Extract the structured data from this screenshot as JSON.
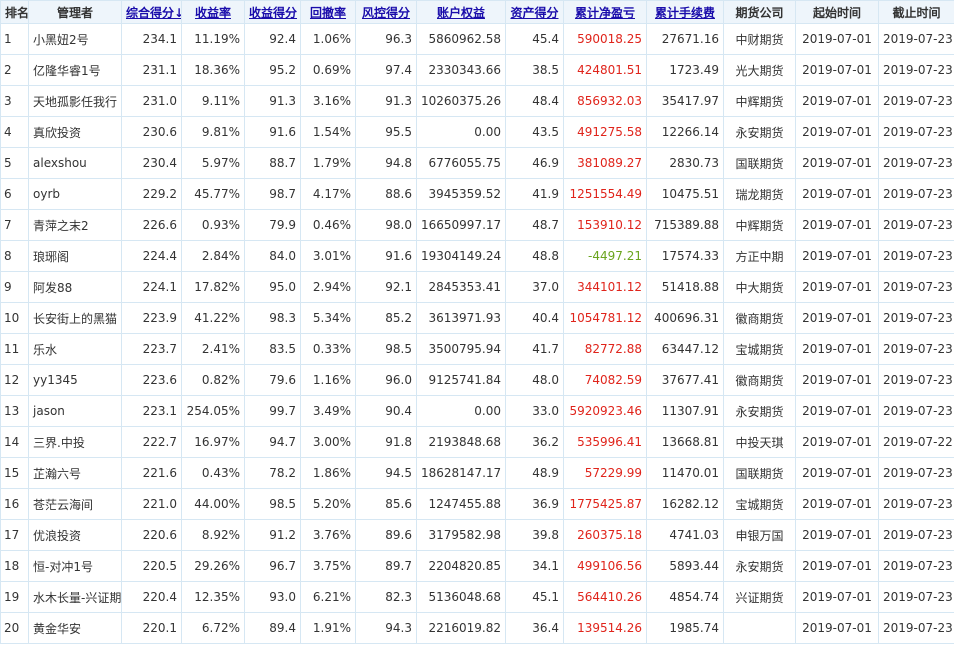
{
  "columns": [
    {
      "key": "rank",
      "label": "排名",
      "sortable": false
    },
    {
      "key": "manager",
      "label": "管理者",
      "sortable": false
    },
    {
      "key": "total_score",
      "label": "综合得分↓",
      "sortable": true
    },
    {
      "key": "return_rate",
      "label": "收益率",
      "sortable": true
    },
    {
      "key": "return_score",
      "label": "收益得分",
      "sortable": true
    },
    {
      "key": "drawdown",
      "label": "回撤率",
      "sortable": true
    },
    {
      "key": "risk_score",
      "label": "风控得分",
      "sortable": true
    },
    {
      "key": "equity",
      "label": "账户权益",
      "sortable": true
    },
    {
      "key": "asset_score",
      "label": "资产得分",
      "sortable": true
    },
    {
      "key": "net_pnl",
      "label": "累计净盈亏",
      "sortable": true
    },
    {
      "key": "fees",
      "label": "累计手续费",
      "sortable": true
    },
    {
      "key": "broker",
      "label": "期货公司",
      "sortable": false
    },
    {
      "key": "start",
      "label": "起始时间",
      "sortable": false
    },
    {
      "key": "end",
      "label": "截止时间",
      "sortable": false
    }
  ],
  "rows": [
    {
      "rank": "1",
      "manager": "小黑妞2号",
      "total_score": "234.1",
      "return_rate": "11.19%",
      "return_score": "92.4",
      "drawdown": "1.06%",
      "risk_score": "96.3",
      "equity": "5860962.58",
      "asset_score": "45.4",
      "net_pnl": "590018.25",
      "fees": "27671.16",
      "broker": "中财期货",
      "start": "2019-07-01",
      "end": "2019-07-23"
    },
    {
      "rank": "2",
      "manager": "亿隆华睿1号",
      "total_score": "231.1",
      "return_rate": "18.36%",
      "return_score": "95.2",
      "drawdown": "0.69%",
      "risk_score": "97.4",
      "equity": "2330343.66",
      "asset_score": "38.5",
      "net_pnl": "424801.51",
      "fees": "1723.49",
      "broker": "光大期货",
      "start": "2019-07-01",
      "end": "2019-07-23"
    },
    {
      "rank": "3",
      "manager": "天地孤影任我行",
      "total_score": "231.0",
      "return_rate": "9.11%",
      "return_score": "91.3",
      "drawdown": "3.16%",
      "risk_score": "91.3",
      "equity": "10260375.26",
      "asset_score": "48.4",
      "net_pnl": "856932.03",
      "fees": "35417.97",
      "broker": "中辉期货",
      "start": "2019-07-01",
      "end": "2019-07-23"
    },
    {
      "rank": "4",
      "manager": "真欣投资",
      "total_score": "230.6",
      "return_rate": "9.81%",
      "return_score": "91.6",
      "drawdown": "1.54%",
      "risk_score": "95.5",
      "equity": "0.00",
      "asset_score": "43.5",
      "net_pnl": "491275.58",
      "fees": "12266.14",
      "broker": "永安期货",
      "start": "2019-07-01",
      "end": "2019-07-23"
    },
    {
      "rank": "5",
      "manager": "alexshou",
      "total_score": "230.4",
      "return_rate": "5.97%",
      "return_score": "88.7",
      "drawdown": "1.79%",
      "risk_score": "94.8",
      "equity": "6776055.75",
      "asset_score": "46.9",
      "net_pnl": "381089.27",
      "fees": "2830.73",
      "broker": "国联期货",
      "start": "2019-07-01",
      "end": "2019-07-23"
    },
    {
      "rank": "6",
      "manager": "oyrb",
      "total_score": "229.2",
      "return_rate": "45.77%",
      "return_score": "98.7",
      "drawdown": "4.17%",
      "risk_score": "88.6",
      "equity": "3945359.52",
      "asset_score": "41.9",
      "net_pnl": "1251554.49",
      "fees": "10475.51",
      "broker": "瑞龙期货",
      "start": "2019-07-01",
      "end": "2019-07-23"
    },
    {
      "rank": "7",
      "manager": "青萍之末2",
      "total_score": "226.6",
      "return_rate": "0.93%",
      "return_score": "79.9",
      "drawdown": "0.46%",
      "risk_score": "98.0",
      "equity": "16650997.17",
      "asset_score": "48.7",
      "net_pnl": "153910.12",
      "fees": "715389.88",
      "broker": "中辉期货",
      "start": "2019-07-01",
      "end": "2019-07-23"
    },
    {
      "rank": "8",
      "manager": "琅琊阁",
      "total_score": "224.4",
      "return_rate": "2.84%",
      "return_score": "84.0",
      "drawdown": "3.01%",
      "risk_score": "91.6",
      "equity": "19304149.24",
      "asset_score": "48.8",
      "net_pnl": "-4497.21",
      "fees": "17574.33",
      "broker": "方正中期",
      "start": "2019-07-01",
      "end": "2019-07-23"
    },
    {
      "rank": "9",
      "manager": "阿发88",
      "total_score": "224.1",
      "return_rate": "17.82%",
      "return_score": "95.0",
      "drawdown": "2.94%",
      "risk_score": "92.1",
      "equity": "2845353.41",
      "asset_score": "37.0",
      "net_pnl": "344101.12",
      "fees": "51418.88",
      "broker": "中大期货",
      "start": "2019-07-01",
      "end": "2019-07-23"
    },
    {
      "rank": "10",
      "manager": "长安街上的黑猫",
      "total_score": "223.9",
      "return_rate": "41.22%",
      "return_score": "98.3",
      "drawdown": "5.34%",
      "risk_score": "85.2",
      "equity": "3613971.93",
      "asset_score": "40.4",
      "net_pnl": "1054781.12",
      "fees": "400696.31",
      "broker": "徽商期货",
      "start": "2019-07-01",
      "end": "2019-07-23"
    },
    {
      "rank": "11",
      "manager": "乐水",
      "total_score": "223.7",
      "return_rate": "2.41%",
      "return_score": "83.5",
      "drawdown": "0.33%",
      "risk_score": "98.5",
      "equity": "3500795.94",
      "asset_score": "41.7",
      "net_pnl": "82772.88",
      "fees": "63447.12",
      "broker": "宝城期货",
      "start": "2019-07-01",
      "end": "2019-07-23"
    },
    {
      "rank": "12",
      "manager": "yy1345",
      "total_score": "223.6",
      "return_rate": "0.82%",
      "return_score": "79.6",
      "drawdown": "1.16%",
      "risk_score": "96.0",
      "equity": "9125741.84",
      "asset_score": "48.0",
      "net_pnl": "74082.59",
      "fees": "37677.41",
      "broker": "徽商期货",
      "start": "2019-07-01",
      "end": "2019-07-23"
    },
    {
      "rank": "13",
      "manager": "jason",
      "total_score": "223.1",
      "return_rate": "254.05%",
      "return_score": "99.7",
      "drawdown": "3.49%",
      "risk_score": "90.4",
      "equity": "0.00",
      "asset_score": "33.0",
      "net_pnl": "5920923.46",
      "fees": "11307.91",
      "broker": "永安期货",
      "start": "2019-07-01",
      "end": "2019-07-23"
    },
    {
      "rank": "14",
      "manager": "三界.中投",
      "total_score": "222.7",
      "return_rate": "16.97%",
      "return_score": "94.7",
      "drawdown": "3.00%",
      "risk_score": "91.8",
      "equity": "2193848.68",
      "asset_score": "36.2",
      "net_pnl": "535996.41",
      "fees": "13668.81",
      "broker": "中投天琪",
      "start": "2019-07-01",
      "end": "2019-07-22"
    },
    {
      "rank": "15",
      "manager": "芷瀚六号",
      "total_score": "221.6",
      "return_rate": "0.43%",
      "return_score": "78.2",
      "drawdown": "1.86%",
      "risk_score": "94.5",
      "equity": "18628147.17",
      "asset_score": "48.9",
      "net_pnl": "57229.99",
      "fees": "11470.01",
      "broker": "国联期货",
      "start": "2019-07-01",
      "end": "2019-07-23"
    },
    {
      "rank": "16",
      "manager": "苍茫云海间",
      "total_score": "221.0",
      "return_rate": "44.00%",
      "return_score": "98.5",
      "drawdown": "5.20%",
      "risk_score": "85.6",
      "equity": "1247455.88",
      "asset_score": "36.9",
      "net_pnl": "1775425.87",
      "fees": "16282.12",
      "broker": "宝城期货",
      "start": "2019-07-01",
      "end": "2019-07-23"
    },
    {
      "rank": "17",
      "manager": "优浪投资",
      "total_score": "220.6",
      "return_rate": "8.92%",
      "return_score": "91.2",
      "drawdown": "3.76%",
      "risk_score": "89.6",
      "equity": "3179582.98",
      "asset_score": "39.8",
      "net_pnl": "260375.18",
      "fees": "4741.03",
      "broker": "申银万国",
      "start": "2019-07-01",
      "end": "2019-07-23"
    },
    {
      "rank": "18",
      "manager": "恒-对冲1号",
      "total_score": "220.5",
      "return_rate": "29.26%",
      "return_score": "96.7",
      "drawdown": "3.75%",
      "risk_score": "89.7",
      "equity": "2204820.85",
      "asset_score": "34.1",
      "net_pnl": "499106.56",
      "fees": "5893.44",
      "broker": "永安期货",
      "start": "2019-07-01",
      "end": "2019-07-23"
    },
    {
      "rank": "19",
      "manager": "水木长量-兴证期",
      "total_score": "220.4",
      "return_rate": "12.35%",
      "return_score": "93.0",
      "drawdown": "6.21%",
      "risk_score": "82.3",
      "equity": "5136048.68",
      "asset_score": "45.1",
      "net_pnl": "564410.26",
      "fees": "4854.74",
      "broker": "兴证期货",
      "start": "2019-07-01",
      "end": "2019-07-23"
    },
    {
      "rank": "20",
      "manager": "黄金华安",
      "total_score": "220.1",
      "return_rate": "6.72%",
      "return_score": "89.4",
      "drawdown": "1.91%",
      "risk_score": "94.3",
      "equity": "2216019.82",
      "asset_score": "36.4",
      "net_pnl": "139514.26",
      "fees": "1985.74",
      "broker": "",
      "start": "2019-07-01",
      "end": "2019-07-23"
    }
  ],
  "colors": {
    "positive": "#e0241b",
    "negative": "#6aa41d",
    "link": "#1a0dab",
    "border": "#d6e7f3",
    "header_bg": "#eef5fb"
  }
}
